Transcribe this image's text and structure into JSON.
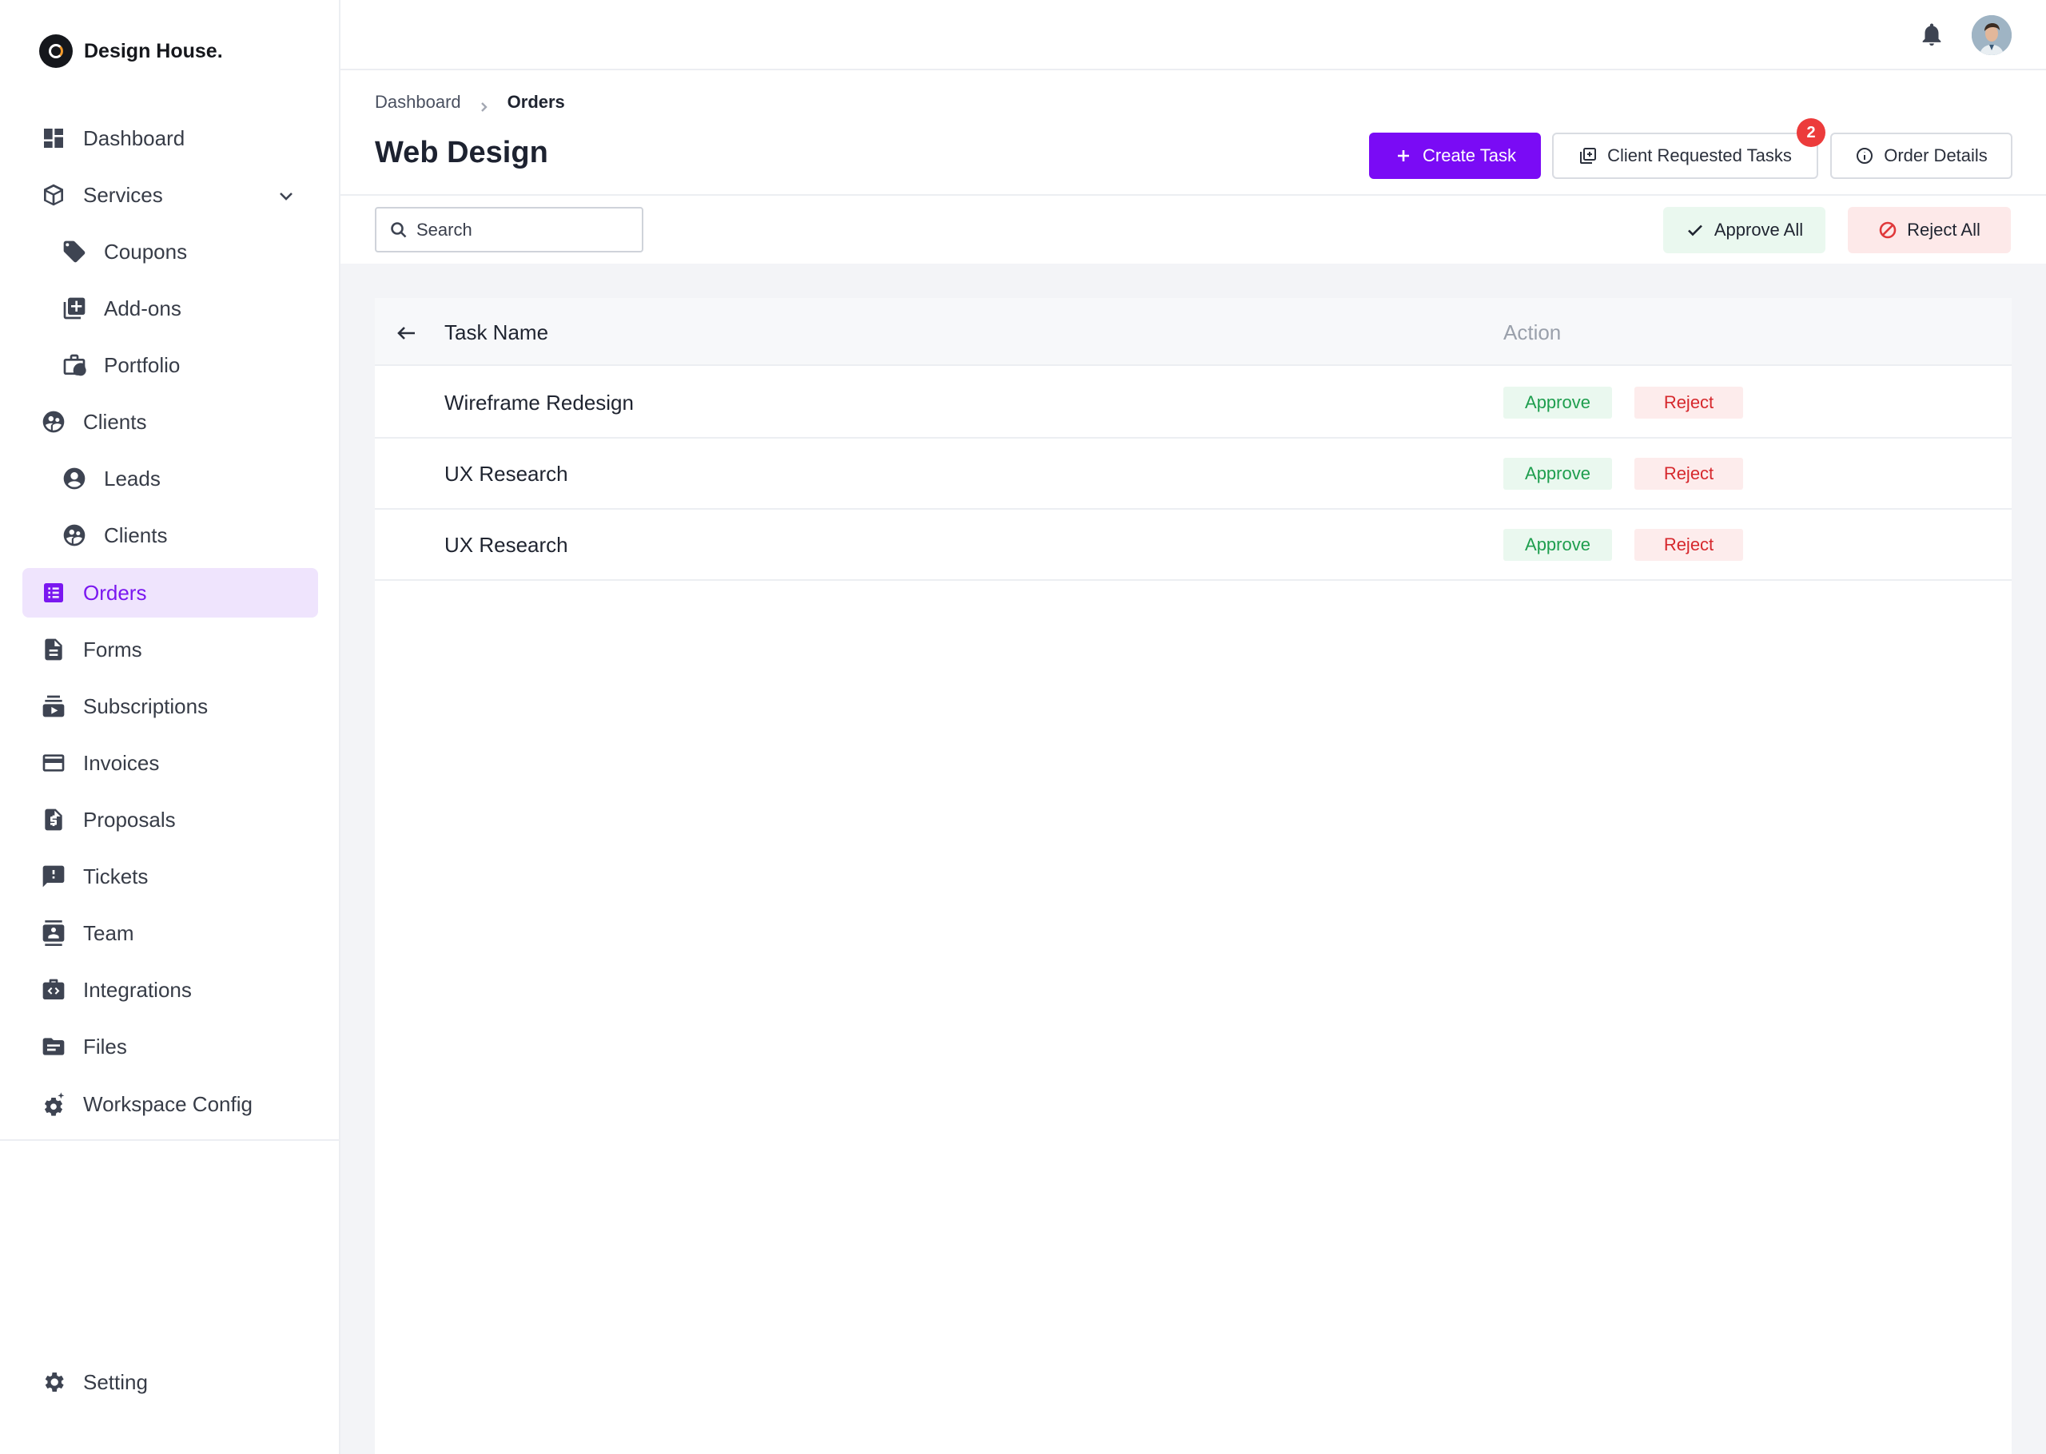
{
  "brand": {
    "name": "Design House."
  },
  "sidebar": {
    "items": [
      {
        "label": "Dashboard",
        "icon": "dashboard-icon"
      },
      {
        "label": "Services",
        "icon": "cube-icon"
      },
      {
        "label": "Coupons",
        "icon": "tag-icon"
      },
      {
        "label": "Add-ons",
        "icon": "library-add-icon"
      },
      {
        "label": "Portfolio",
        "icon": "briefcase-clock-icon"
      },
      {
        "label": "Clients",
        "icon": "group-icon"
      },
      {
        "label": "Leads",
        "icon": "account-circle-icon"
      },
      {
        "label": "Clients",
        "icon": "group-icon"
      },
      {
        "label": "Orders",
        "icon": "list-box-icon"
      },
      {
        "label": "Forms",
        "icon": "document-icon"
      },
      {
        "label": "Subscriptions",
        "icon": "subscriptions-icon"
      },
      {
        "label": "Invoices",
        "icon": "credit-card-icon"
      },
      {
        "label": "Proposals",
        "icon": "dollar-file-icon"
      },
      {
        "label": "Tickets",
        "icon": "feedback-icon"
      },
      {
        "label": "Team",
        "icon": "contact-card-icon"
      },
      {
        "label": "Integrations",
        "icon": "code-case-icon"
      },
      {
        "label": "Files",
        "icon": "folder-icon"
      },
      {
        "label": "Workspace Config",
        "icon": "gear-sparkle-icon"
      }
    ],
    "setting": {
      "label": "Setting",
      "icon": "gear-icon"
    }
  },
  "breadcrumb": {
    "root": "Dashboard",
    "current": "Orders"
  },
  "page": {
    "title": "Web Design"
  },
  "actions": {
    "create_task": "Create Task",
    "client_requested": "Client Requested Tasks",
    "client_requested_count": "2",
    "order_details": "Order Details",
    "approve_all": "Approve All",
    "reject_all": "Reject All"
  },
  "search": {
    "placeholder": "Search"
  },
  "table": {
    "headers": {
      "name": "Task Name",
      "action": "Action"
    },
    "rows": [
      {
        "name": "Wireframe Redesign",
        "approve": "Approve",
        "reject": "Reject"
      },
      {
        "name": "UX Research",
        "approve": "Approve",
        "reject": "Reject"
      },
      {
        "name": "UX Research",
        "approve": "Approve",
        "reject": "Reject"
      }
    ]
  },
  "colors": {
    "accent": "#7a0bf5",
    "active_bg": "#efe4fd",
    "approve_text": "#1e9e4e",
    "reject_text": "#d6282d",
    "badge": "#ec3b3b"
  }
}
